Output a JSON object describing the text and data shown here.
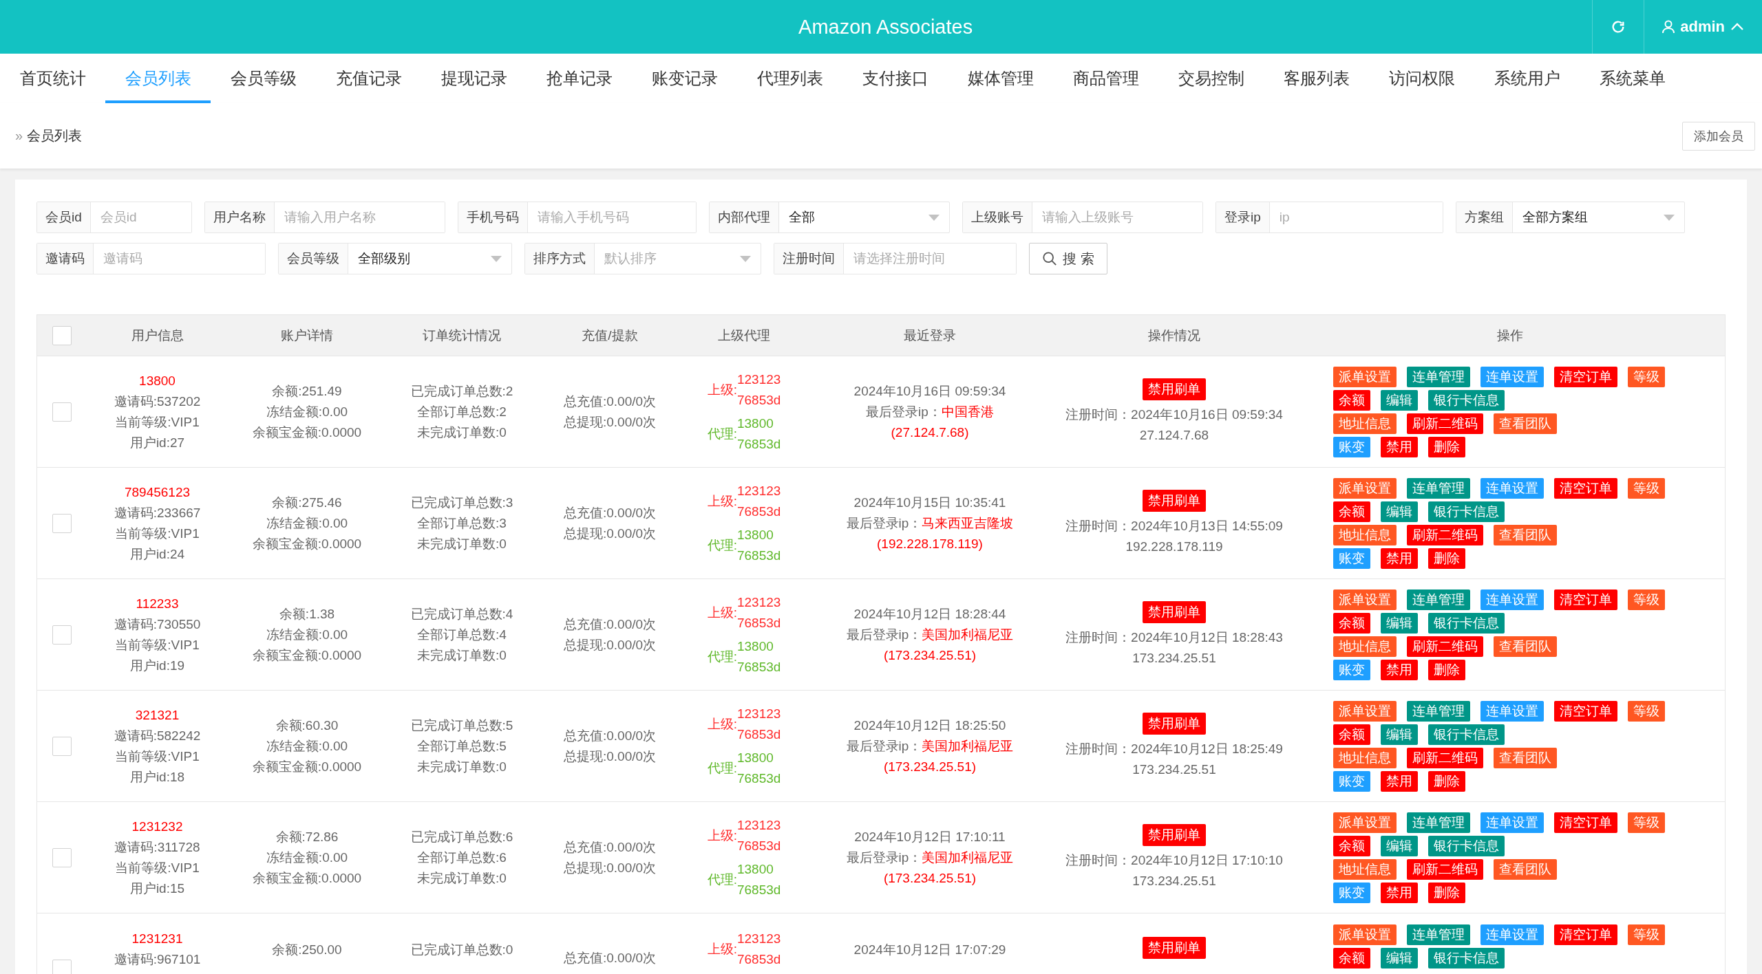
{
  "header": {
    "title": "Amazon Associates",
    "user": "admin"
  },
  "nav": [
    {
      "label": "首页统计",
      "selected": false
    },
    {
      "label": "会员列表",
      "selected": true
    },
    {
      "label": "会员等级",
      "selected": false
    },
    {
      "label": "充值记录",
      "selected": false
    },
    {
      "label": "提现记录",
      "selected": false
    },
    {
      "label": "抢单记录",
      "selected": false
    },
    {
      "label": "账变记录",
      "selected": false
    },
    {
      "label": "代理列表",
      "selected": false
    },
    {
      "label": "支付接口",
      "selected": false
    },
    {
      "label": "媒体管理",
      "selected": false
    },
    {
      "label": "商品管理",
      "selected": false
    },
    {
      "label": "交易控制",
      "selected": false
    },
    {
      "label": "客服列表",
      "selected": false
    },
    {
      "label": "访问权限",
      "selected": false
    },
    {
      "label": "系统用户",
      "selected": false
    },
    {
      "label": "系统菜单",
      "selected": false
    }
  ],
  "breadcrumb": {
    "separator": "»",
    "label": "会员列表"
  },
  "add_button": "添加会员",
  "filters": [
    [
      {
        "kind": "input",
        "label": "会员id",
        "placeholder": "会员id"
      },
      {
        "kind": "input",
        "label": "用户名称",
        "placeholder": "请输入用户名称"
      },
      {
        "kind": "input",
        "label": "手机号码",
        "placeholder": "请输入手机号码"
      },
      {
        "kind": "select",
        "label": "内部代理",
        "value": "全部"
      },
      {
        "kind": "input",
        "label": "上级账号",
        "placeholder": "请输入上级账号"
      },
      {
        "kind": "input",
        "label": "登录ip",
        "placeholder": "ip"
      },
      {
        "kind": "select",
        "label": "方案组",
        "value": "全部方案组"
      }
    ],
    [
      {
        "kind": "input",
        "label": "邀请码",
        "placeholder": "邀请码"
      },
      {
        "kind": "select",
        "label": "会员等级",
        "value": "全部级别"
      },
      {
        "kind": "select",
        "label": "排序方式",
        "placeholder": "默认排序"
      },
      {
        "kind": "input",
        "label": "注册时间",
        "placeholder": "请选择注册时间"
      }
    ]
  ],
  "search_button": "搜 索",
  "table": {
    "select_all": false,
    "columns": [
      "用户信息",
      "账户详情",
      "订单统计情况",
      "充值/提款",
      "上级代理",
      "最近登录",
      "操作情况",
      "操作"
    ],
    "rows": [
      {
        "checked": false,
        "username": "13800",
        "info": [
          "邀请码:537202",
          "当前等级:VIP1",
          "用户id:27"
        ],
        "account": [
          "余额:251.49",
          "冻结金额:0.00",
          "余额宝金额:0.0000"
        ],
        "orders": [
          "已完成订单总数:2",
          "全部订单总数:2",
          "未完成订单数:0"
        ],
        "funds": [
          "总充值:0.00/0次",
          "总提现:0.00/0次"
        ],
        "agents": [
          {
            "kind": "parent",
            "label": "上级:",
            "values": [
              "123123",
              "76853d"
            ]
          },
          {
            "kind": "agent",
            "label": "代理:",
            "values": [
              "13800",
              "76853d"
            ]
          }
        ],
        "login_time": "2024年10月16日 09:59:34",
        "login_ip_label": "最后登录ip：",
        "login_location": "中国香港",
        "login_ip": "(27.124.7.68)",
        "badge": "禁用刷单",
        "reg_time": "注册时间：2024年10月16日 09:59:34",
        "reg_ip": "27.124.7.68",
        "actions": [
          [
            {
              "label": "派单设置",
              "color": "#ff5722"
            },
            {
              "label": "连单管理",
              "color": "#009688"
            },
            {
              "label": "连单设置",
              "color": "#1e9fff"
            },
            {
              "label": "清空订单",
              "color": "#ff0000"
            },
            {
              "label": "等级",
              "color": "#ff5722"
            }
          ],
          [
            {
              "label": "余额",
              "color": "#ff0000"
            },
            {
              "label": "编辑",
              "color": "#009688"
            },
            {
              "label": "银行卡信息",
              "color": "#009688"
            }
          ],
          [
            {
              "label": "地址信息",
              "color": "#ff5722"
            },
            {
              "label": "刷新二维码",
              "color": "#ff0000"
            },
            {
              "label": "查看团队",
              "color": "#ff5722"
            }
          ],
          [
            {
              "label": "账变",
              "color": "#1e9fff"
            },
            {
              "label": "禁用",
              "color": "#ff0000"
            },
            {
              "label": "删除",
              "color": "#ff0000"
            }
          ]
        ]
      },
      {
        "checked": false,
        "username": "789456123",
        "info": [
          "邀请码:233667",
          "当前等级:VIP1",
          "用户id:24"
        ],
        "account": [
          "余额:275.46",
          "冻结金额:0.00",
          "余额宝金额:0.0000"
        ],
        "orders": [
          "已完成订单总数:3",
          "全部订单总数:3",
          "未完成订单数:0"
        ],
        "funds": [
          "总充值:0.00/0次",
          "总提现:0.00/0次"
        ],
        "agents": [
          {
            "kind": "parent",
            "label": "上级:",
            "values": [
              "123123",
              "76853d"
            ]
          },
          {
            "kind": "agent",
            "label": "代理:",
            "values": [
              "13800",
              "76853d"
            ]
          }
        ],
        "login_time": "2024年10月15日 10:35:41",
        "login_ip_label": "最后登录ip：",
        "login_location": "马来西亚吉隆坡",
        "login_ip": "(192.228.178.119)",
        "badge": "禁用刷单",
        "reg_time": "注册时间：2024年10月13日 14:55:09",
        "reg_ip": "192.228.178.119",
        "actions": [
          [
            {
              "label": "派单设置",
              "color": "#ff5722"
            },
            {
              "label": "连单管理",
              "color": "#009688"
            },
            {
              "label": "连单设置",
              "color": "#1e9fff"
            },
            {
              "label": "清空订单",
              "color": "#ff0000"
            },
            {
              "label": "等级",
              "color": "#ff5722"
            }
          ],
          [
            {
              "label": "余额",
              "color": "#ff0000"
            },
            {
              "label": "编辑",
              "color": "#009688"
            },
            {
              "label": "银行卡信息",
              "color": "#009688"
            }
          ],
          [
            {
              "label": "地址信息",
              "color": "#ff5722"
            },
            {
              "label": "刷新二维码",
              "color": "#ff0000"
            },
            {
              "label": "查看团队",
              "color": "#ff5722"
            }
          ],
          [
            {
              "label": "账变",
              "color": "#1e9fff"
            },
            {
              "label": "禁用",
              "color": "#ff0000"
            },
            {
              "label": "删除",
              "color": "#ff0000"
            }
          ]
        ]
      },
      {
        "checked": false,
        "username": "112233",
        "info": [
          "邀请码:730550",
          "当前等级:VIP1",
          "用户id:19"
        ],
        "account": [
          "余额:1.38",
          "冻结金额:0.00",
          "余额宝金额:0.0000"
        ],
        "orders": [
          "已完成订单总数:4",
          "全部订单总数:4",
          "未完成订单数:0"
        ],
        "funds": [
          "总充值:0.00/0次",
          "总提现:0.00/0次"
        ],
        "agents": [
          {
            "kind": "parent",
            "label": "上级:",
            "values": [
              "123123",
              "76853d"
            ]
          },
          {
            "kind": "agent",
            "label": "代理:",
            "values": [
              "13800",
              "76853d"
            ]
          }
        ],
        "login_time": "2024年10月12日 18:28:44",
        "login_ip_label": "最后登录ip：",
        "login_location": "美国加利福尼亚",
        "login_ip": "(173.234.25.51)",
        "badge": "禁用刷单",
        "reg_time": "注册时间：2024年10月12日 18:28:43",
        "reg_ip": "173.234.25.51",
        "actions": [
          [
            {
              "label": "派单设置",
              "color": "#ff5722"
            },
            {
              "label": "连单管理",
              "color": "#009688"
            },
            {
              "label": "连单设置",
              "color": "#1e9fff"
            },
            {
              "label": "清空订单",
              "color": "#ff0000"
            },
            {
              "label": "等级",
              "color": "#ff5722"
            }
          ],
          [
            {
              "label": "余额",
              "color": "#ff0000"
            },
            {
              "label": "编辑",
              "color": "#009688"
            },
            {
              "label": "银行卡信息",
              "color": "#009688"
            }
          ],
          [
            {
              "label": "地址信息",
              "color": "#ff5722"
            },
            {
              "label": "刷新二维码",
              "color": "#ff0000"
            },
            {
              "label": "查看团队",
              "color": "#ff5722"
            }
          ],
          [
            {
              "label": "账变",
              "color": "#1e9fff"
            },
            {
              "label": "禁用",
              "color": "#ff0000"
            },
            {
              "label": "删除",
              "color": "#ff0000"
            }
          ]
        ]
      },
      {
        "checked": false,
        "username": "321321",
        "info": [
          "邀请码:582242",
          "当前等级:VIP1",
          "用户id:18"
        ],
        "account": [
          "余额:60.30",
          "冻结金额:0.00",
          "余额宝金额:0.0000"
        ],
        "orders": [
          "已完成订单总数:5",
          "全部订单总数:5",
          "未完成订单数:0"
        ],
        "funds": [
          "总充值:0.00/0次",
          "总提现:0.00/0次"
        ],
        "agents": [
          {
            "kind": "parent",
            "label": "上级:",
            "values": [
              "123123",
              "76853d"
            ]
          },
          {
            "kind": "agent",
            "label": "代理:",
            "values": [
              "13800",
              "76853d"
            ]
          }
        ],
        "login_time": "2024年10月12日 18:25:50",
        "login_ip_label": "最后登录ip：",
        "login_location": "美国加利福尼亚",
        "login_ip": "(173.234.25.51)",
        "badge": "禁用刷单",
        "reg_time": "注册时间：2024年10月12日 18:25:49",
        "reg_ip": "173.234.25.51",
        "actions": [
          [
            {
              "label": "派单设置",
              "color": "#ff5722"
            },
            {
              "label": "连单管理",
              "color": "#009688"
            },
            {
              "label": "连单设置",
              "color": "#1e9fff"
            },
            {
              "label": "清空订单",
              "color": "#ff0000"
            },
            {
              "label": "等级",
              "color": "#ff5722"
            }
          ],
          [
            {
              "label": "余额",
              "color": "#ff0000"
            },
            {
              "label": "编辑",
              "color": "#009688"
            },
            {
              "label": "银行卡信息",
              "color": "#009688"
            }
          ],
          [
            {
              "label": "地址信息",
              "color": "#ff5722"
            },
            {
              "label": "刷新二维码",
              "color": "#ff0000"
            },
            {
              "label": "查看团队",
              "color": "#ff5722"
            }
          ],
          [
            {
              "label": "账变",
              "color": "#1e9fff"
            },
            {
              "label": "禁用",
              "color": "#ff0000"
            },
            {
              "label": "删除",
              "color": "#ff0000"
            }
          ]
        ]
      },
      {
        "checked": false,
        "username": "1231232",
        "info": [
          "邀请码:311728",
          "当前等级:VIP1",
          "用户id:15"
        ],
        "account": [
          "余额:72.86",
          "冻结金额:0.00",
          "余额宝金额:0.0000"
        ],
        "orders": [
          "已完成订单总数:6",
          "全部订单总数:6",
          "未完成订单数:0"
        ],
        "funds": [
          "总充值:0.00/0次",
          "总提现:0.00/0次"
        ],
        "agents": [
          {
            "kind": "parent",
            "label": "上级:",
            "values": [
              "123123",
              "76853d"
            ]
          },
          {
            "kind": "agent",
            "label": "代理:",
            "values": [
              "13800",
              "76853d"
            ]
          }
        ],
        "login_time": "2024年10月12日 17:10:11",
        "login_ip_label": "最后登录ip：",
        "login_location": "美国加利福尼亚",
        "login_ip": "(173.234.25.51)",
        "badge": "禁用刷单",
        "reg_time": "注册时间：2024年10月12日 17:10:10",
        "reg_ip": "173.234.25.51",
        "actions": [
          [
            {
              "label": "派单设置",
              "color": "#ff5722"
            },
            {
              "label": "连单管理",
              "color": "#009688"
            },
            {
              "label": "连单设置",
              "color": "#1e9fff"
            },
            {
              "label": "清空订单",
              "color": "#ff0000"
            },
            {
              "label": "等级",
              "color": "#ff5722"
            }
          ],
          [
            {
              "label": "余额",
              "color": "#ff0000"
            },
            {
              "label": "编辑",
              "color": "#009688"
            },
            {
              "label": "银行卡信息",
              "color": "#009688"
            }
          ],
          [
            {
              "label": "地址信息",
              "color": "#ff5722"
            },
            {
              "label": "刷新二维码",
              "color": "#ff0000"
            },
            {
              "label": "查看团队",
              "color": "#ff5722"
            }
          ],
          [
            {
              "label": "账变",
              "color": "#1e9fff"
            },
            {
              "label": "禁用",
              "color": "#ff0000"
            },
            {
              "label": "删除",
              "color": "#ff0000"
            }
          ]
        ]
      },
      {
        "checked": false,
        "username": "1231231",
        "info": [
          "邀请码:967101"
        ],
        "account": [
          "余额:250.00"
        ],
        "orders": [
          "已完成订单总数:0"
        ],
        "funds": [
          "总充值:0.00/0次"
        ],
        "agents": [
          {
            "kind": "parent",
            "label": "上级:",
            "values": [
              "123123",
              "76853d"
            ]
          }
        ],
        "login_time": "2024年10月12日 17:07:29",
        "badge": "禁用刷单",
        "actions": [
          [
            {
              "label": "派单设置",
              "color": "#ff5722"
            },
            {
              "label": "连单管理",
              "color": "#009688"
            },
            {
              "label": "连单设置",
              "color": "#1e9fff"
            },
            {
              "label": "清空订单",
              "color": "#ff0000"
            },
            {
              "label": "等级",
              "color": "#ff5722"
            }
          ],
          [
            {
              "label": "余额",
              "color": "#ff0000"
            },
            {
              "label": "编辑",
              "color": "#009688"
            },
            {
              "label": "银行卡信息",
              "color": "#009688"
            }
          ]
        ]
      }
    ]
  }
}
